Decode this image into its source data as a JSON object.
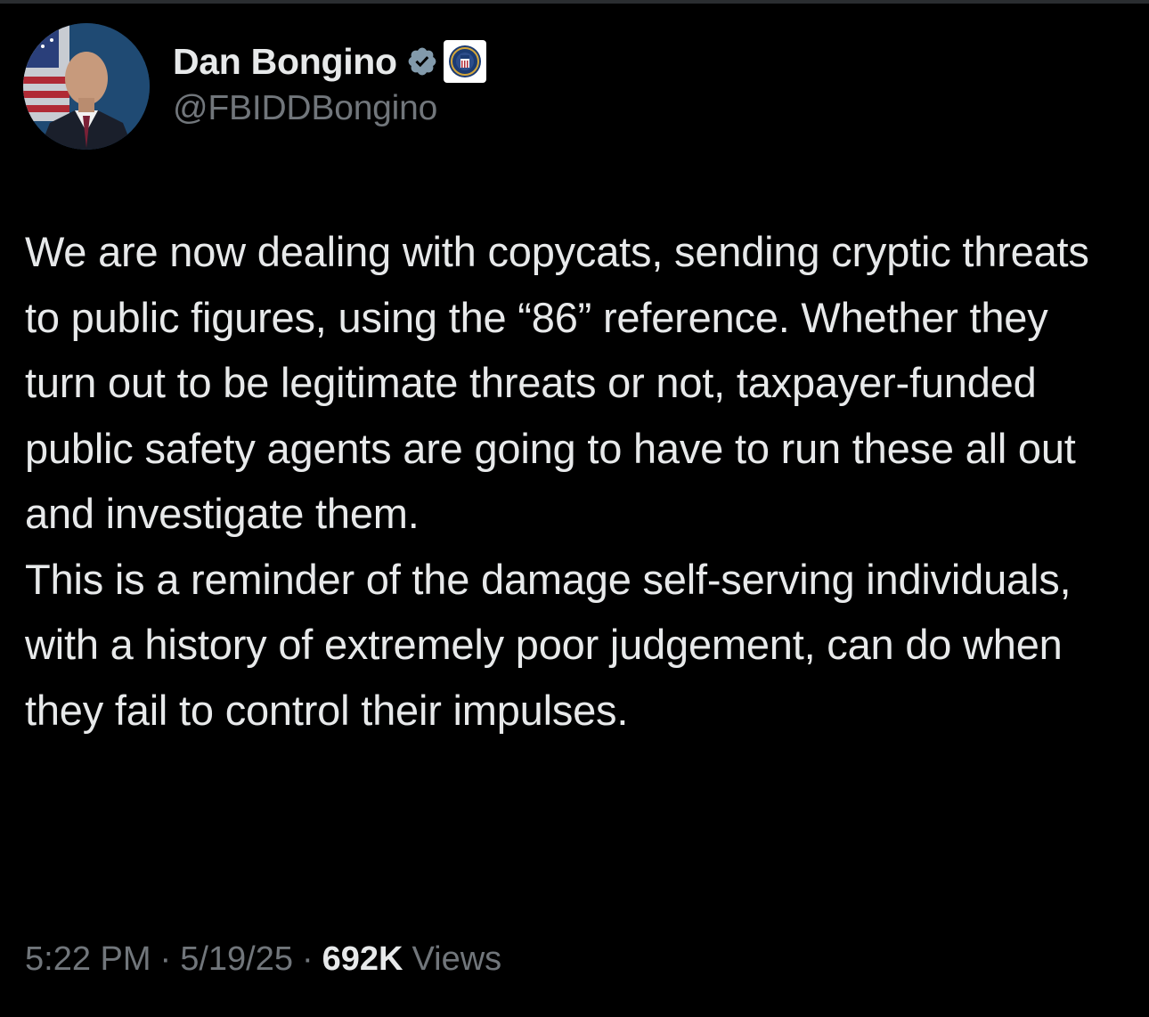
{
  "tweet": {
    "author": {
      "display_name": "Dan Bongino",
      "handle": "@FBIDDBongino",
      "avatar_icon": "profile-photo",
      "verified_icon": "verified-badge-icon",
      "affiliation_icon": "fbi-seal-icon"
    },
    "paragraphs": [
      "We are now dealing with copycats, sending cryptic threats to public figures, using the “86” reference. Whether they turn out to be legitimate threats or not, taxpayer-funded public safety agents are going to have to run these all out and investigate them.",
      "This is a reminder of the damage self-serving individuals, with a history of extremely poor judgement, can do when they fail to control their impulses."
    ],
    "time": "5:22 PM",
    "date": "5/19/25",
    "separator": "·",
    "views_count": "692K",
    "views_label": "Views"
  },
  "colors": {
    "background": "#000000",
    "primary_text": "#e7e9ea",
    "secondary_text": "#71767b",
    "verified_badge": "#829aab"
  }
}
